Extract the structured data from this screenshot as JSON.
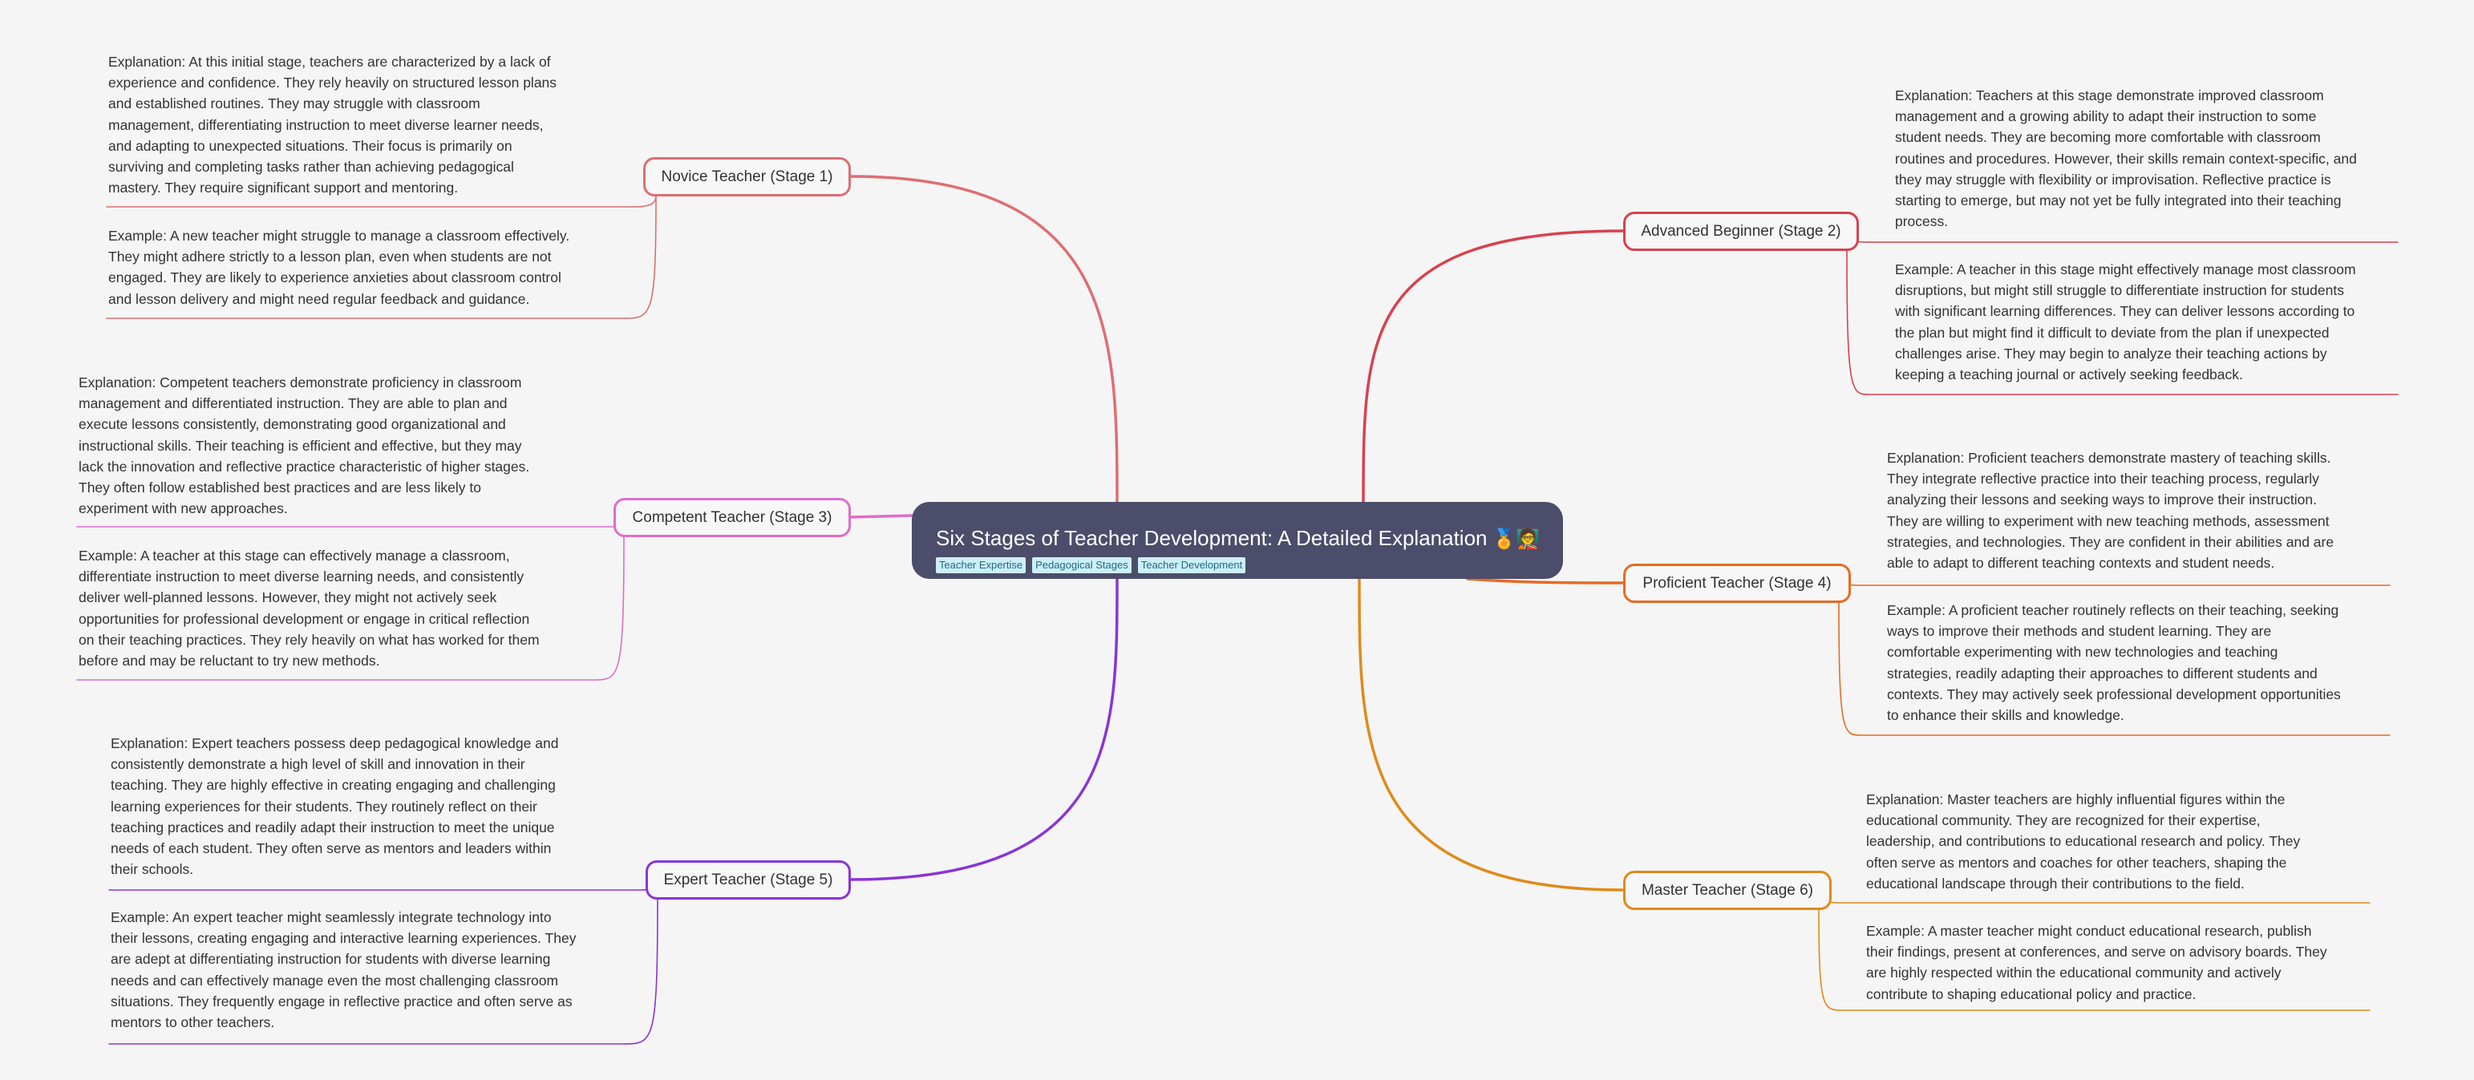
{
  "root": {
    "title": "Six Stages of Teacher Development: A Detailed Explanation",
    "emoji": "🏅🧑‍🏫",
    "tags": [
      "Teacher Expertise",
      "Pedagogical Stages",
      "Teacher Development"
    ]
  },
  "colors": {
    "novice": "#de6e72",
    "advanced": "#d9414f",
    "competent": "#e06cc9",
    "proficient": "#e66b22",
    "expert": "#8a35d6",
    "master": "#e08a1a"
  },
  "stages": {
    "novice": {
      "label": "Novice Teacher (Stage 1)",
      "explanation": "Explanation: At this initial stage, teachers are characterized by a lack of\nexperience and confidence.  They rely heavily on structured lesson plans\nand established routines.  They may struggle with classroom\nmanagement, differentiating instruction to meet diverse learner needs,\nand adapting to unexpected situations.  Their focus is primarily on\nsurviving and completing tasks rather than achieving pedagogical\nmastery.  They require significant support and mentoring.",
      "example": "Example: A new teacher might struggle to manage a classroom effectively.\nThey might adhere strictly to a lesson plan, even when students are not\nengaged. They are likely to experience anxieties about classroom control\nand lesson delivery and might need regular feedback and guidance."
    },
    "advanced": {
      "label": "Advanced Beginner (Stage 2)",
      "explanation": "Explanation: Teachers at this stage demonstrate improved classroom\nmanagement and a growing ability to adapt their instruction to some\nstudent needs. They are becoming more comfortable with classroom\nroutines and procedures. However, their skills remain context-specific, and\nthey may struggle with flexibility or improvisation. Reflective practice is\nstarting to emerge, but may not yet be fully integrated into their teaching\nprocess.",
      "example": "Example: A teacher in this stage might effectively manage most classroom\ndisruptions, but might still struggle to differentiate instruction for students\nwith significant learning differences.  They can deliver lessons according to\nthe plan but might find it difficult to deviate from the plan if unexpected\nchallenges arise. They may begin to analyze their teaching actions by\nkeeping a teaching journal or actively seeking feedback."
    },
    "competent": {
      "label": "Competent Teacher (Stage 3)",
      "explanation": "Explanation:  Competent teachers demonstrate proficiency in classroom\nmanagement and differentiated instruction. They are able to plan and\nexecute lessons consistently, demonstrating good organizational and\ninstructional skills.  Their teaching is efficient and effective, but they may\nlack the innovation and reflective practice characteristic of higher stages.\nThey often follow established best practices and are less likely to\nexperiment with new approaches.",
      "example": "Example: A teacher at this stage can effectively manage a classroom,\ndifferentiate instruction to meet diverse learning needs, and consistently\ndeliver well-planned lessons.  However, they might not actively seek\nopportunities for professional development or engage in critical reflection\non their teaching practices. They rely heavily on what has worked for them\nbefore and may be reluctant to try new methods."
    },
    "proficient": {
      "label": "Proficient Teacher (Stage 4)",
      "explanation": "Explanation:  Proficient teachers demonstrate mastery of teaching skills.\nThey integrate reflective practice into their teaching process, regularly\nanalyzing their lessons and seeking ways to improve their instruction.\nThey are willing to experiment with new teaching methods, assessment\nstrategies, and technologies. They are confident in their abilities and are\nable to adapt to different teaching contexts and student needs.",
      "example": "Example: A proficient teacher routinely reflects on their teaching, seeking\nways to improve their methods and student learning. They are\ncomfortable experimenting with new technologies and teaching\nstrategies, readily adapting their approaches to different students and\ncontexts. They may actively seek professional development opportunities\nto enhance their skills and knowledge."
    },
    "expert": {
      "label": "Expert Teacher (Stage 5)",
      "explanation": "Explanation: Expert teachers possess deep pedagogical knowledge and\nconsistently demonstrate a high level of skill and innovation in their\nteaching. They are highly effective in creating engaging and challenging\nlearning experiences for their students.  They routinely reflect on their\nteaching practices and readily adapt their instruction to meet the unique\nneeds of each student.  They often serve as mentors and leaders within\ntheir schools.",
      "example": "Example: An expert teacher might seamlessly integrate technology into\ntheir lessons, creating engaging and interactive learning experiences. They\nare adept at differentiating instruction for students with diverse learning\nneeds and can effectively manage even the most challenging classroom\nsituations. They frequently engage in reflective practice and often serve as\nmentors to other teachers."
    },
    "master": {
      "label": "Master Teacher (Stage 6)",
      "explanation": "Explanation: Master teachers are highly influential figures within the\neducational community.  They are recognized for their expertise,\nleadership, and contributions to educational research and policy.  They\noften serve as mentors and coaches for other teachers, shaping the\neducational landscape through their contributions to the field.",
      "example": "Example: A master teacher might conduct educational research, publish\ntheir findings, present at conferences, and serve on advisory boards. They\nare highly respected within the educational community and actively\ncontribute to shaping educational policy and practice."
    }
  }
}
